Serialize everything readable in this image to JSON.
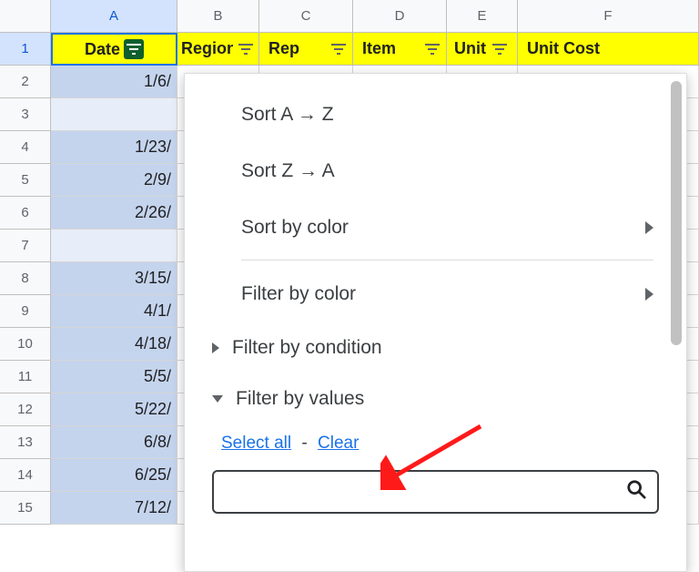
{
  "columns": [
    "A",
    "B",
    "C",
    "D",
    "E",
    "F"
  ],
  "rows": [
    "1",
    "2",
    "3",
    "4",
    "5",
    "6",
    "7",
    "8",
    "9",
    "10",
    "11",
    "12",
    "13",
    "14",
    "15"
  ],
  "headers": {
    "A": "Date",
    "B": "Region",
    "C": "Rep",
    "D": "Item",
    "E": "Unit",
    "F": "Unit Cost"
  },
  "dates": {
    "r2": "1/6/",
    "r3": "",
    "r4": "1/23/",
    "r5": "2/9/",
    "r6": "2/26/",
    "r7": "",
    "r8": "3/15/",
    "r9": "4/1/",
    "r10": "4/18/",
    "r11": "5/5/",
    "r12": "5/22/",
    "r13": "6/8/",
    "r14": "6/25/",
    "r15": "7/12/"
  },
  "popup": {
    "sort_az": "Sort A → Z",
    "sort_za": "Sort Z → A",
    "sort_color": "Sort by color",
    "filter_color": "Filter by color",
    "filter_cond": "Filter by condition",
    "filter_vals": "Filter by values",
    "select_all": "Select all",
    "clear": "Clear",
    "search_placeholder": ""
  }
}
